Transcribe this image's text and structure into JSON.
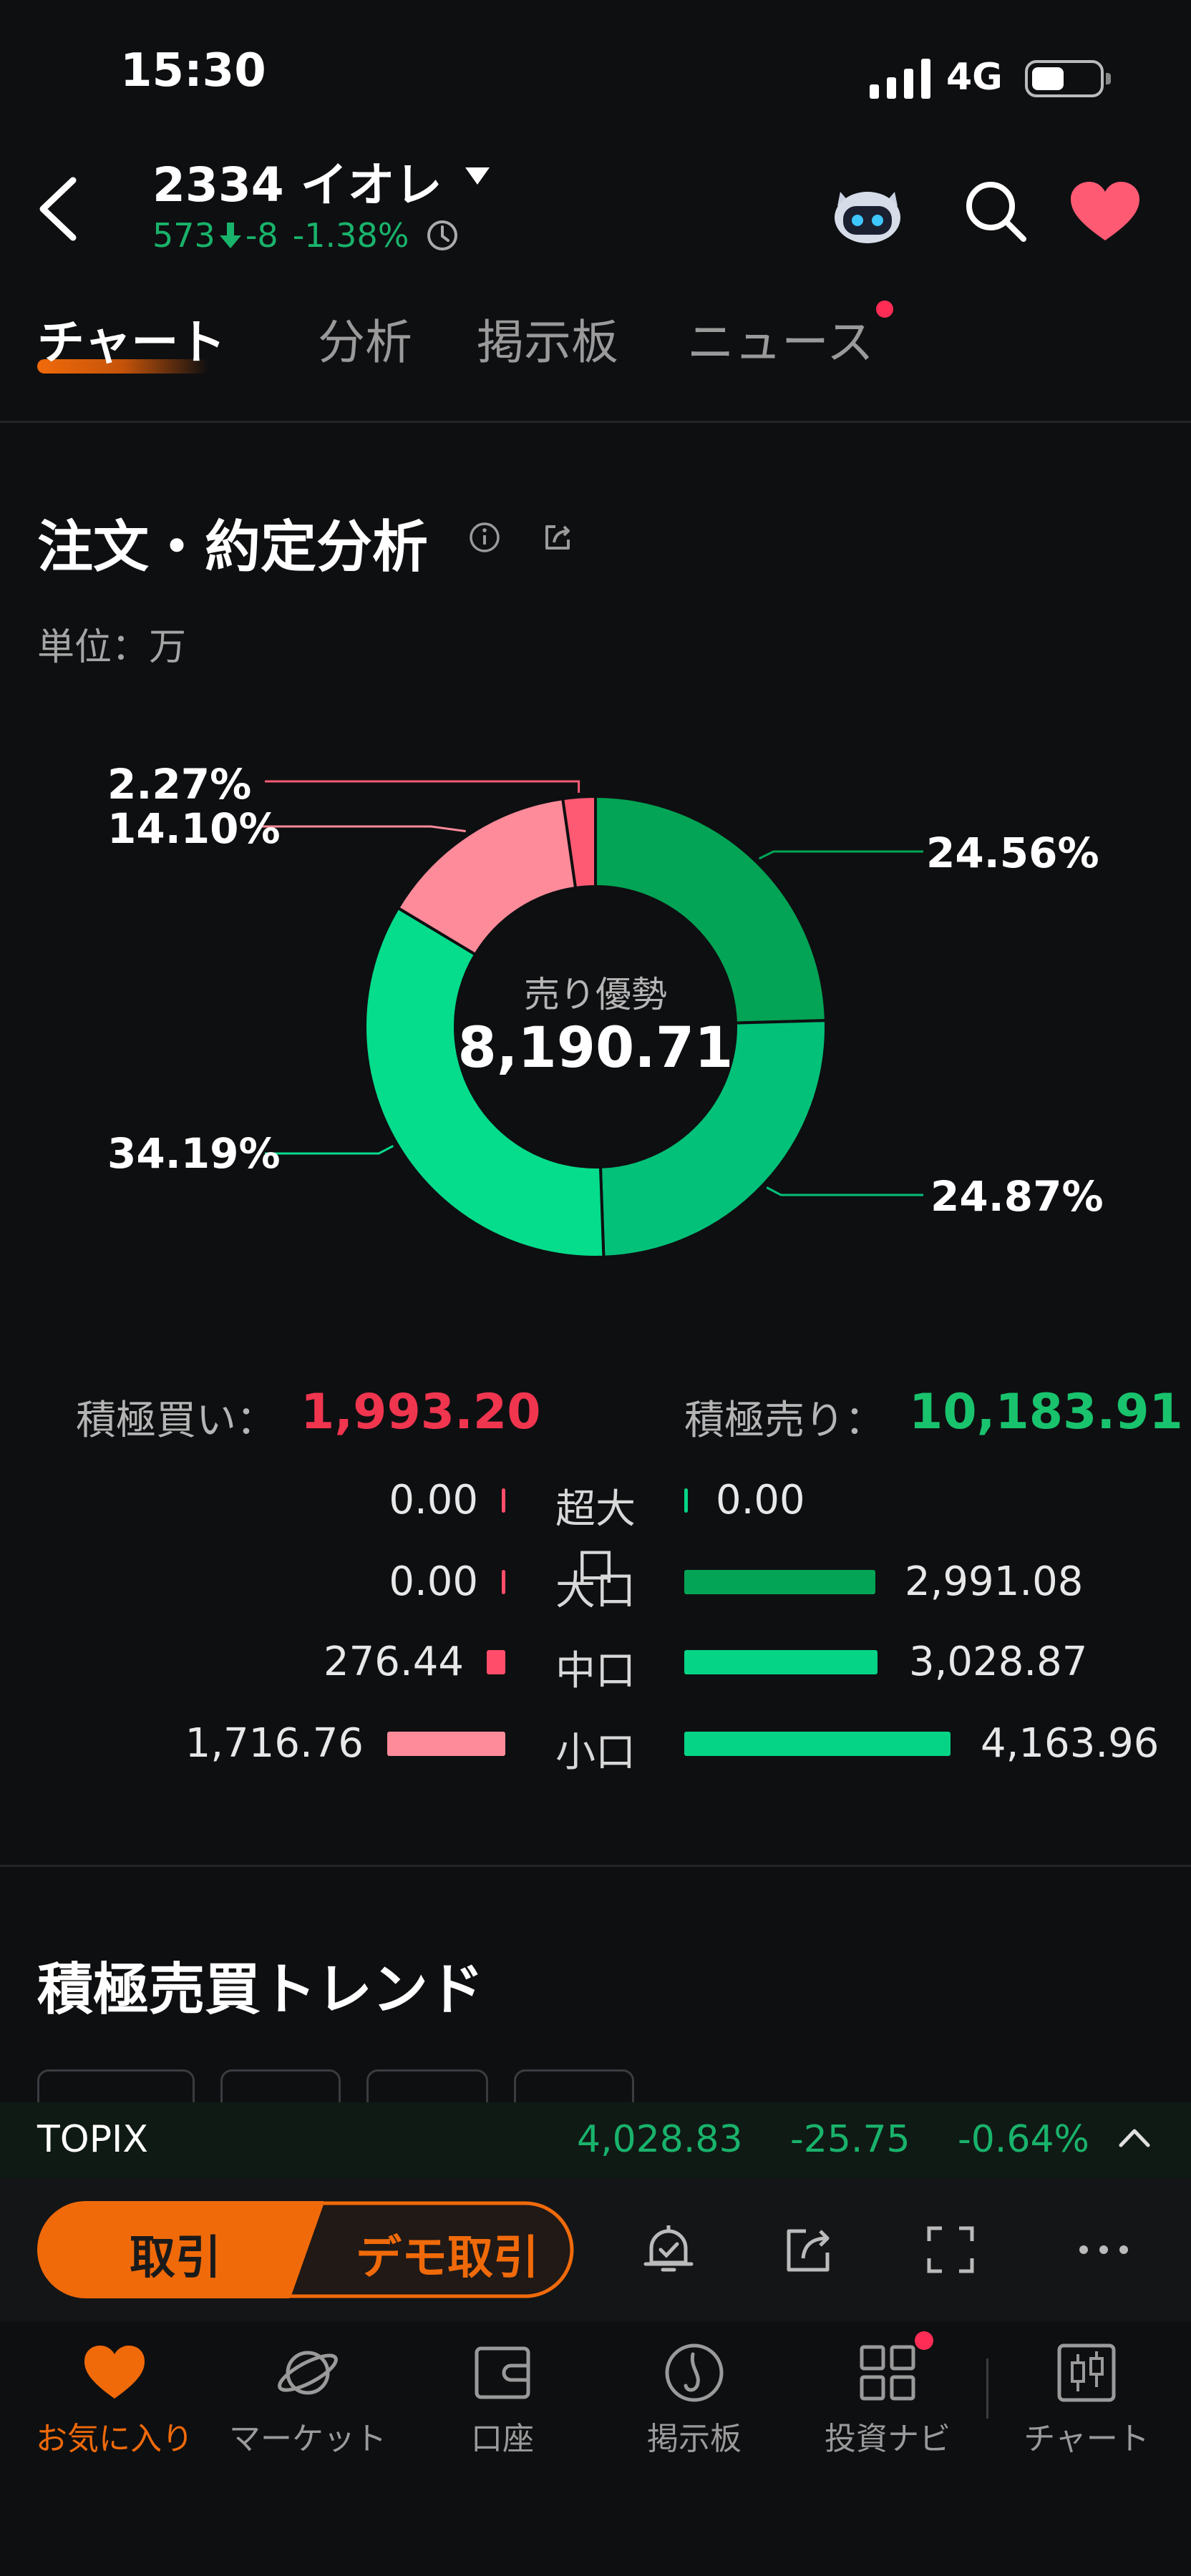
{
  "status_bar": {
    "time": "15:30",
    "network": "4G",
    "battery_level": 0.4
  },
  "header": {
    "title": "2334  イオレ",
    "price": "573",
    "change": "-8",
    "change_pct": "-1.38%"
  },
  "tabs": [
    {
      "label": "チャート",
      "active": true
    },
    {
      "label": "分析",
      "active": false
    },
    {
      "label": "掲示板",
      "active": false
    },
    {
      "label": "ニュース",
      "active": false
    }
  ],
  "analysis": {
    "title": "注文・約定分析",
    "unit": "単位：万",
    "center_label": "売り優勢",
    "center_value": "8,190.71"
  },
  "chart_data": {
    "type": "pie",
    "slices": [
      {
        "label": "24.56%",
        "value": 24.56,
        "color": "#03a455",
        "side": "sell",
        "size": "大口"
      },
      {
        "label": "24.87%",
        "value": 24.87,
        "color": "#04c17a",
        "side": "sell",
        "size": "中口"
      },
      {
        "label": "34.19%",
        "value": 34.19,
        "color": "#05dd8c",
        "side": "sell",
        "size": "小口"
      },
      {
        "label": "14.10%",
        "value": 14.1,
        "color": "#fd8b9a",
        "side": "buy",
        "size": "小口"
      },
      {
        "label": "2.27%",
        "value": 2.27,
        "color": "#ff5a73",
        "side": "buy",
        "size": "中口"
      }
    ]
  },
  "summary": {
    "buy_label": "積極買い：",
    "buy_value": "1,993.20",
    "sell_label": "積極売り：",
    "sell_value": "10,183.91",
    "buy_color": "#f0354f",
    "sell_color": "#19c36d"
  },
  "breakdown": [
    {
      "category": "超大口",
      "buy": "0.00",
      "sell": "0.00",
      "buy_ratio": 0,
      "sell_ratio": 0
    },
    {
      "category": "大口",
      "buy": "0.00",
      "sell": "2,991.08",
      "buy_ratio": 0,
      "sell_ratio": 0.718
    },
    {
      "category": "中口",
      "buy": "276.44",
      "sell": "3,028.87",
      "buy_ratio": 0.066,
      "sell_ratio": 0.727
    },
    {
      "category": "小口",
      "buy": "1,716.76",
      "sell": "4,163.96",
      "buy_ratio": 0.412,
      "sell_ratio": 1.0
    }
  ],
  "trend": {
    "title": "積極売買トレンド"
  },
  "ticker": {
    "name": "TOPIX",
    "value": "4,028.83",
    "change": "-25.75",
    "change_pct": "-0.64%"
  },
  "actions": {
    "trade_label": "取引",
    "demo_label": "デモ取引"
  },
  "bottom_nav": [
    {
      "label": "お気に入り",
      "icon": "heart-icon",
      "active": true
    },
    {
      "label": "マーケット",
      "icon": "planet-icon",
      "active": false
    },
    {
      "label": "口座",
      "icon": "wallet-icon",
      "active": false
    },
    {
      "label": "掲示板",
      "icon": "board-icon",
      "active": false
    },
    {
      "label": "投資ナビ",
      "icon": "grid-icon",
      "active": false
    },
    {
      "label": "チャート",
      "icon": "candlestick-icon",
      "active": false
    }
  ]
}
